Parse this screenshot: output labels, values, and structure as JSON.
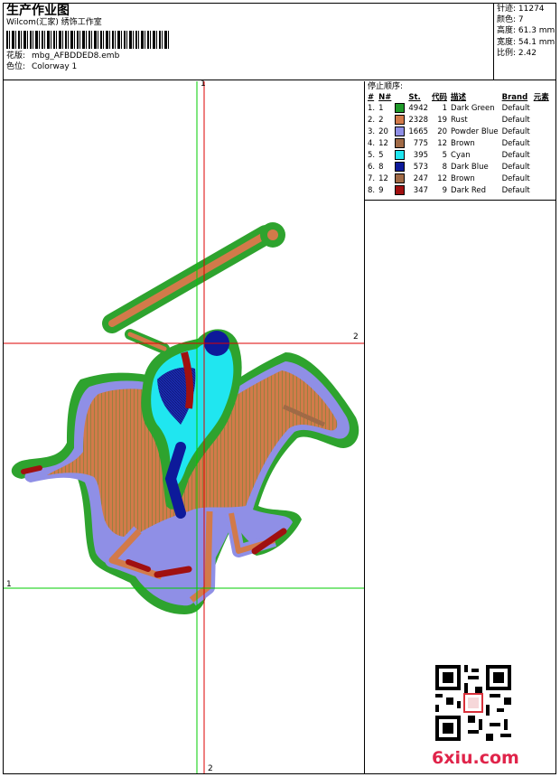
{
  "header": {
    "title": "生产作业图",
    "subtitle": "Wilcom(汇家) 绣饰工作室",
    "design_label": "花版:",
    "design_value": "mbg_AFBDDED8.emb",
    "colorway_label": "色位:",
    "colorway_value": "Colorway 1"
  },
  "stats": {
    "stitches": "针迹: 11274",
    "colors": "颜色: 7",
    "height": "高度: 61.3 mm",
    "width": "宽度: 54.1 mm",
    "scale": "比例: 2.42"
  },
  "guides": {
    "marker_1": "1",
    "marker_2": "2"
  },
  "sequence": {
    "title": "停止顺序:",
    "headers": [
      "#",
      "N#",
      "St.",
      "代码",
      "描述",
      "Brand",
      "元素"
    ],
    "rows": [
      {
        "idx": "1.",
        "n": "1",
        "color": "#1f9a2a",
        "st": "4942",
        "code": "1",
        "desc": "Dark Green",
        "brand": "Default"
      },
      {
        "idx": "2.",
        "n": "2",
        "color": "#d27a4a",
        "st": "2328",
        "code": "19",
        "desc": "Rust",
        "brand": "Default"
      },
      {
        "idx": "3.",
        "n": "20",
        "color": "#8f8fe6",
        "st": "1665",
        "code": "20",
        "desc": "Powder Blue",
        "brand": "Default"
      },
      {
        "idx": "4.",
        "n": "12",
        "color": "#a06a46",
        "st": "775",
        "code": "12",
        "desc": "Brown",
        "brand": "Default"
      },
      {
        "idx": "5.",
        "n": "5",
        "color": "#20e6f0",
        "st": "395",
        "code": "5",
        "desc": "Cyan",
        "brand": "Default"
      },
      {
        "idx": "6.",
        "n": "8",
        "color": "#0d1a9a",
        "st": "573",
        "code": "8",
        "desc": "Dark Blue",
        "brand": "Default"
      },
      {
        "idx": "7.",
        "n": "12",
        "color": "#a06a46",
        "st": "247",
        "code": "12",
        "desc": "Brown",
        "brand": "Default"
      },
      {
        "idx": "8.",
        "n": "9",
        "color": "#a01010",
        "st": "347",
        "code": "9",
        "desc": "Dark Red",
        "brand": "Default"
      }
    ]
  },
  "watermark": "6xiu.com",
  "colors": {
    "guide_green": "#00cc00",
    "guide_red": "#dd0000",
    "brand_red": "#e0244a"
  }
}
